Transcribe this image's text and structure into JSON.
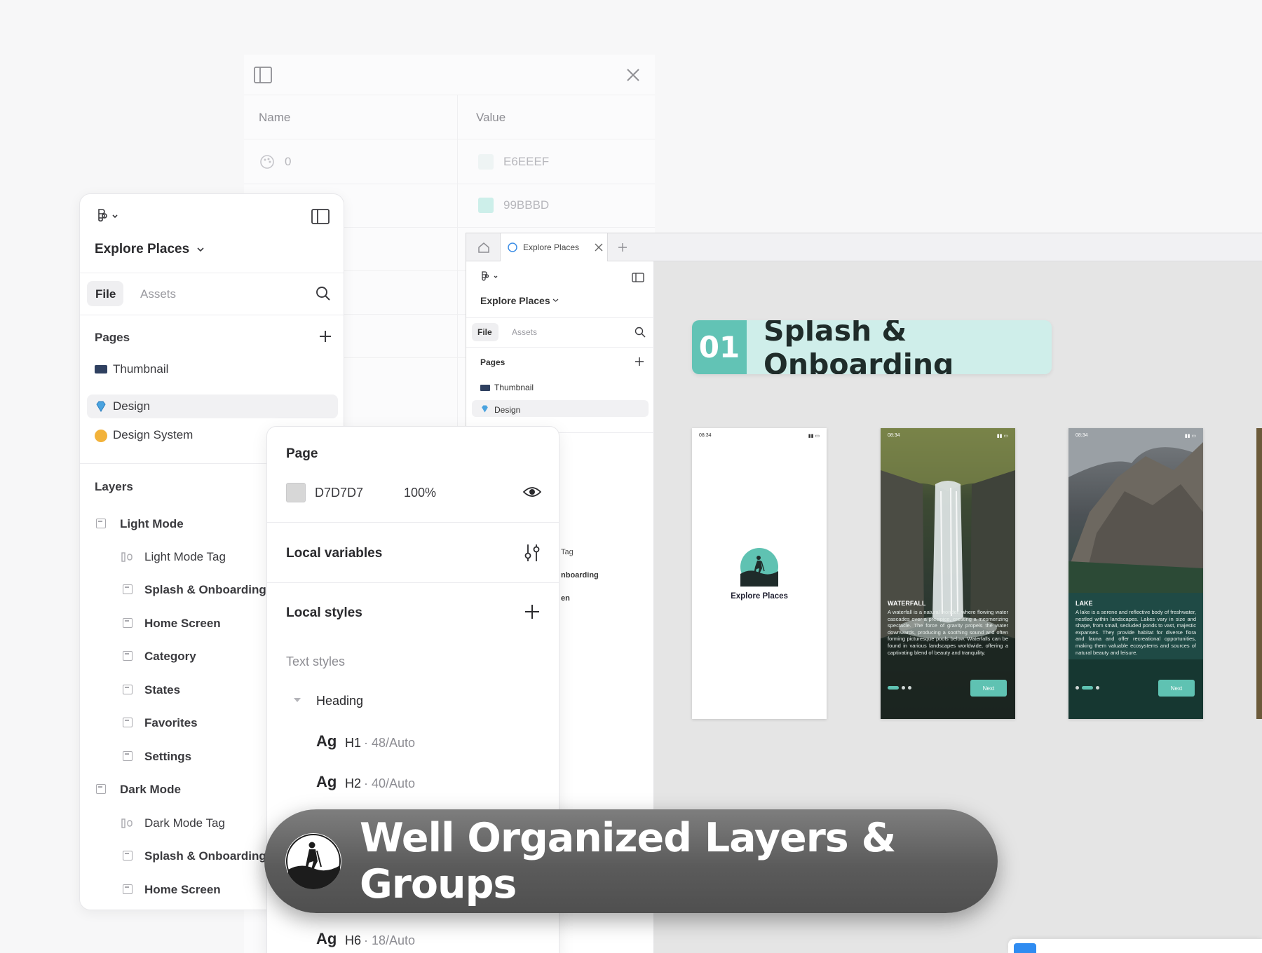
{
  "variables_panel": {
    "col_name": "Name",
    "col_value": "Value",
    "rows": [
      {
        "name": "0",
        "value": "E6EEEF",
        "color": "#E6EEEF"
      },
      {
        "name": "",
        "value": "99BBBD",
        "color": "#CDEFEA"
      }
    ]
  },
  "left_panel": {
    "project": "Explore Places",
    "tabs": {
      "file": "File",
      "assets": "Assets"
    },
    "pages_label": "Pages",
    "pages": [
      {
        "icon": "laptop-icon",
        "label": "Thumbnail"
      },
      {
        "icon": "gem-icon",
        "label": "Design"
      },
      {
        "icon": "palette-icon",
        "label": "Design System"
      }
    ],
    "layers_label": "Layers",
    "layers": [
      {
        "label": "Light Mode",
        "level": 0
      },
      {
        "label": "Light Mode Tag",
        "level": 1
      },
      {
        "label": "Splash & Onboarding",
        "level": 1
      },
      {
        "label": "Home Screen",
        "level": 1
      },
      {
        "label": "Category",
        "level": 1
      },
      {
        "label": "States",
        "level": 1
      },
      {
        "label": "Favorites",
        "level": 1
      },
      {
        "label": "Settings",
        "level": 1
      },
      {
        "label": "Dark Mode",
        "level": 0
      },
      {
        "label": "Dark Mode Tag",
        "level": 1
      },
      {
        "label": "Splash & Onboarding",
        "level": 1
      },
      {
        "label": "Home Screen",
        "level": 1
      }
    ]
  },
  "browser": {
    "tab_label": "Explore Places",
    "inner": {
      "project": "Explore Places",
      "file": "File",
      "assets": "Assets",
      "pages_label": "Pages",
      "pages": [
        "Thumbnail",
        "Design"
      ],
      "partial_layers": [
        "Tag",
        "nboarding",
        "en"
      ]
    }
  },
  "properties": {
    "page_label": "Page",
    "page_color": "D7D7D7",
    "page_color_hex": "#D7D7D7",
    "opacity": "100%",
    "local_variables": "Local variables",
    "local_styles": "Local styles",
    "text_styles": "Text styles",
    "group": "Heading",
    "styles": [
      {
        "sample": "Ag",
        "name": "H1",
        "spec": "· 48/Auto"
      },
      {
        "sample": "Ag",
        "name": "H2",
        "spec": "· 40/Auto"
      },
      {
        "sample": "Ag",
        "name": "H6",
        "spec": "· 18/Auto"
      }
    ]
  },
  "canvas": {
    "section_number": "01",
    "section_title": "Splash & Onboarding",
    "accent": "#62C3B5",
    "screens": [
      {
        "time": "08:34",
        "logo_text": "Explore Places"
      },
      {
        "time": "08:34",
        "title": "WATERFALL",
        "body": "A waterfall is a natural wonder, where flowing water cascades over a precipice, creating a mesmerizing spectacle. The force of gravity propels the water downwards, producing a soothing sound and often forming picturesque pools below. Waterfalls can be found in various landscapes worldwide, offering a captivating blend of beauty and tranquility.",
        "button": "Next"
      },
      {
        "time": "08:34",
        "title": "LAKE",
        "body": "A lake is a serene and reflective body of freshwater, nestled within landscapes. Lakes vary in size and shape, from small, secluded ponds to vast, majestic expanses. They provide habitat for diverse flora and fauna and offer recreational opportunities, making them valuable ecosystems and sources of natural beauty and leisure.",
        "button": "Next"
      }
    ]
  },
  "banner": {
    "text": "Well Organized Layers & Groups"
  }
}
